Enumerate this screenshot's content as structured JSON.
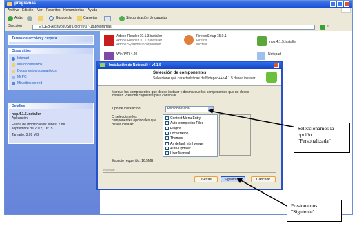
{
  "window": {
    "title": "programas",
    "menu": [
      "Archivo",
      "Edición",
      "Ver",
      "Favoritos",
      "Herramientas",
      "Ayuda"
    ],
    "toolbar": {
      "back": "Atrás",
      "search": "Búsqueda",
      "folders": "Carpetas",
      "sync": "Sincronización de carpetas"
    },
    "address_label": "Dirección",
    "address_value": "E:\\CEB-ArchivosUSB\\Dolores\\07-18\\programas",
    "go_label": "Ir"
  },
  "sidebar": {
    "tasks_title": "Tareas de archivo y carpeta",
    "places_title": "Otros sitios",
    "places": [
      "Internet",
      "Mis documentos",
      "Documentos compartidos",
      "Mi PC",
      "Mis sitios de red"
    ],
    "details_title": "Detalles",
    "details": {
      "filename": "npp.4.1.5.Installer",
      "type": "Aplicación",
      "modified": "Fecha de modificación: lunes, 2 de",
      "modified2": "septiembre de 2012, 16:75",
      "size": "Tamaño: 3,09 MB"
    }
  },
  "files": [
    {
      "name": "Adobe Reader 10.1.3.installer",
      "line2": "Adobe Reader 10.1.3.installer",
      "line3": "Adobe Systems Incorporated"
    },
    {
      "name": "FirefoxSetup 15.0.1",
      "line2": "Firefox",
      "line3": "Mozilla"
    },
    {
      "name": "npp.4.1.5.Installer",
      "line2": "",
      "line3": ""
    },
    {
      "name": "WinRAR 4.20",
      "line2": "",
      "line3": ""
    },
    {
      "name": "Notepad",
      "line2": "",
      "line3": ""
    }
  ],
  "dialog": {
    "title": "Instalación de Notepad++ v4.1.5",
    "header_title": "Selección de componentes",
    "header_sub": "Seleccione qué características de Notepad++ v4.1.5 desea instalar.",
    "instructions": "Marque los componentes que desee instalar y desmarque los componentes que no desee instalar. Presione Siguiente para continuar.",
    "type_label": "Tipo de instalación:",
    "type_value": "Personalizada",
    "or_label": "O seleccione los componentes opcionales que desea instalar:",
    "components": [
      "Context Menu Entry",
      "Auto-completion Files",
      "Plugins",
      "Localization",
      "Themes",
      "As default html viewer",
      "Auto-Updater",
      "User Manual"
    ],
    "checked": [
      true,
      true,
      true,
      true,
      true,
      false,
      true,
      true
    ],
    "space_label": "Espacio requerido: 16.5MB",
    "brand": "Nullsoft",
    "buttons": {
      "back": "< Atrás",
      "next": "Siguiente >",
      "cancel": "Cancelar"
    }
  },
  "callouts": {
    "top": "Seleccionamos la opción \"Personalizada\"",
    "bottom": "Presionamos \"Siguiente\""
  },
  "colors": {
    "xp_blue": "#2552c9",
    "task_blue": "#6b8fd6"
  }
}
